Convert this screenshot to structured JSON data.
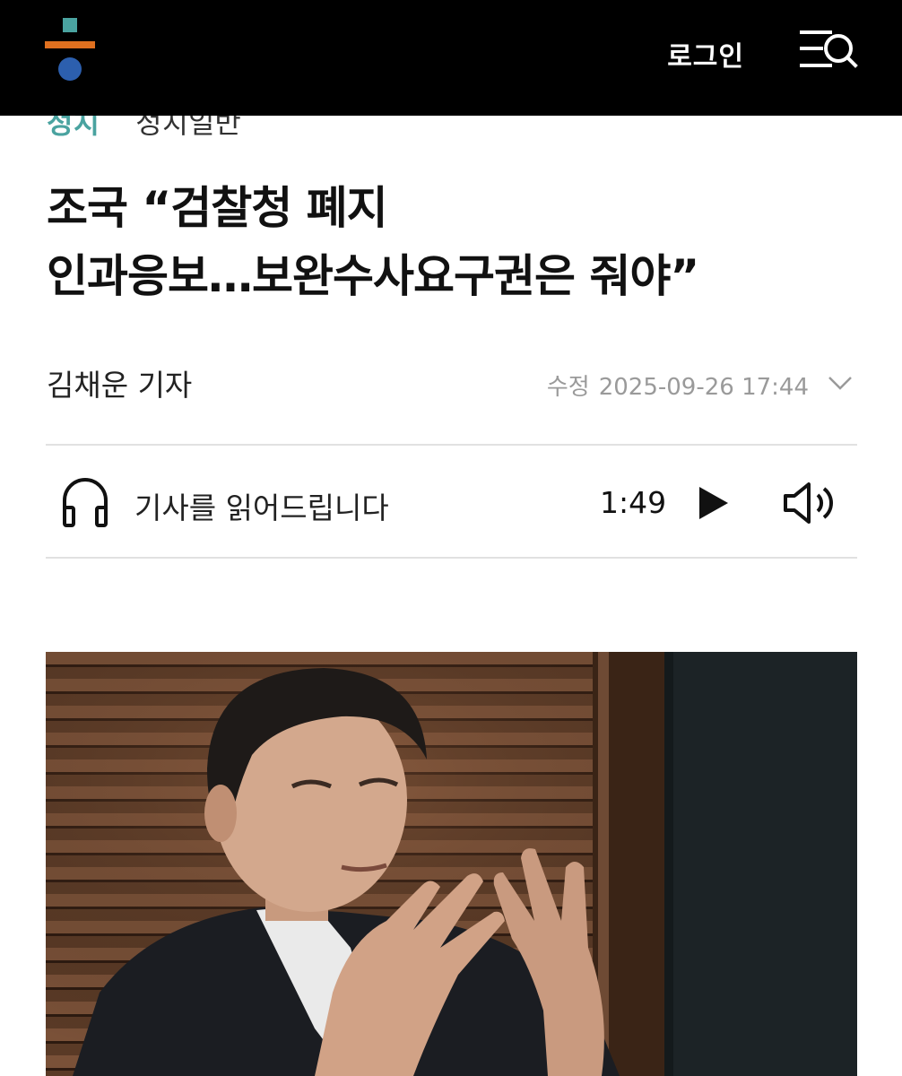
{
  "header": {
    "login_label": "로그인",
    "logo_icon": "hankyoreh-logo-icon",
    "menu_icon": "menu-search-icon"
  },
  "article": {
    "section": "정치",
    "subsection": "정치일반",
    "headline_line1": "조국 “검찰청 폐지",
    "headline_line2": "인과응보…보완수사요구권은 줘야”",
    "reporter": "김채운 기자",
    "timestamp_label": "수정",
    "timestamp": "2025-09-26 17:44"
  },
  "audio": {
    "label": "기사를 읽어드립니다",
    "duration": "1:49",
    "icons": [
      "headphones-icon",
      "play-icon",
      "volume-icon"
    ]
  },
  "colors": {
    "header_bg": "#000000",
    "section_accent": "#4aa3a0",
    "logo_teal": "#4aa3a0",
    "logo_orange": "#e0701f",
    "logo_blue": "#2c5fae"
  }
}
